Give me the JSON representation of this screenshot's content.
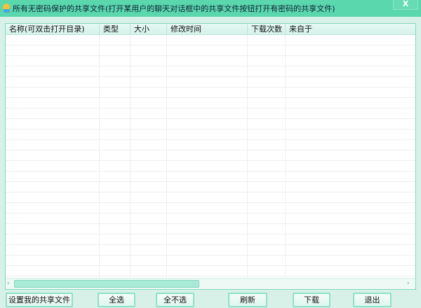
{
  "window": {
    "title": "所有无密码保护的共享文件(打开某用户的聊天对话框中的共享文件按钮打开有密码的共享文件)",
    "close_label": "X"
  },
  "list": {
    "columns": [
      "名称(可双击打开目录)",
      "类型",
      "大小",
      "修改时间",
      "下载次数",
      "来自于"
    ],
    "rows": []
  },
  "scrollbar": {
    "left": "‹",
    "right": "›"
  },
  "buttons": {
    "share": "设置我的共享文件",
    "select_all": "全选",
    "select_none": "全不选",
    "refresh": "刷新",
    "download": "下载",
    "exit": "退出"
  }
}
